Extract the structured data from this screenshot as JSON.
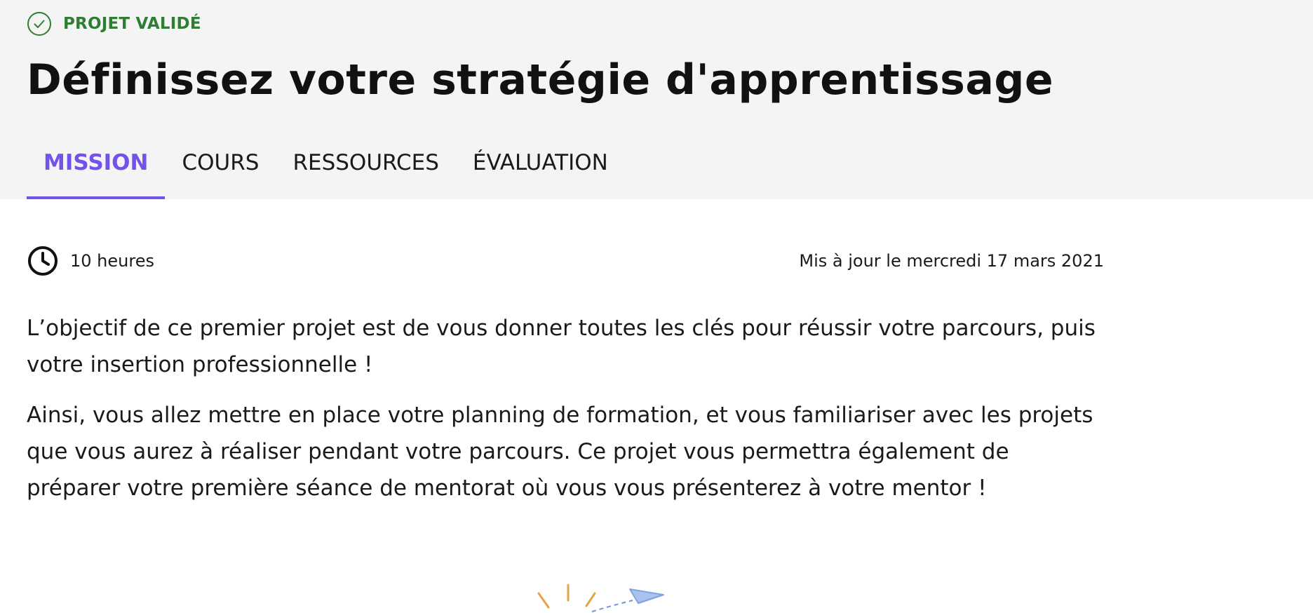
{
  "project": {
    "status_label": "PROJET VALIDÉ",
    "title": "Définissez votre stratégie d'apprentissage"
  },
  "tabs": [
    {
      "label": "MISSION",
      "active": true
    },
    {
      "label": "COURS",
      "active": false
    },
    {
      "label": "RESSOURCES",
      "active": false
    },
    {
      "label": "ÉVALUATION",
      "active": false
    }
  ],
  "meta": {
    "duration": "10 heures",
    "updated": "Mis à jour le mercredi 17 mars 2021"
  },
  "content": {
    "paragraphs": [
      "L’objectif de ce premier projet est de vous donner toutes les clés pour réussir votre parcours, puis votre insertion professionnelle !",
      "Ainsi, vous allez mettre en place votre planning de formation, et vous familiariser avec les projets que vous aurez à réaliser pendant votre parcours. Ce projet vous permettra également de préparer votre première séance de mentorat où vous vous présenterez à votre mentor !"
    ]
  },
  "icons": {
    "status": "check-circle-icon",
    "duration": "clock-icon",
    "illustration": "paper-plane-icon"
  },
  "colors": {
    "accent": "#7451eb",
    "success": "#2e7d32",
    "header_bg": "#f4f4f4"
  }
}
